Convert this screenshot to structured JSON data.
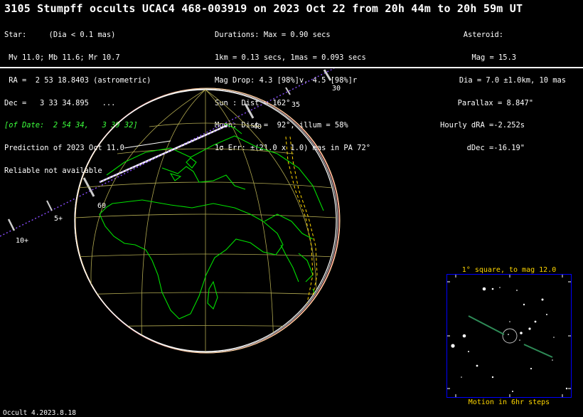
{
  "title": "3105 Stumpff occults UCAC4 468-003919 on 2023 Oct 22 from 20h 44m to 20h 59m UT",
  "star_info": [
    "Star:     (Dia < 0.1 mas)",
    " Mv 11.0; Mb 11.6; Mr 10.7",
    " RA =  2 53 18.8403 (astrometric)",
    "Dec =   3 33 34.895   ...",
    "[of Date:  2 54 34,   3 39 32]",
    "Prediction of 2023 Oct 11.0",
    "Reliable not available"
  ],
  "event_info": [
    "Durations: Max = 0.90 secs",
    "1km = 0.13 secs, 1mas = 0.093 secs",
    "Mag Drop: 4.3 [98%]v, 4.5 [98%]r",
    "Sun : Dist = 162°",
    "Moon: Dist =  92°, illum = 58%",
    "1σ Err: ±(21.0 x 1.0) mas in PA 72°"
  ],
  "asteroid_info": [
    "Asteroid:",
    "Mag = 15.3",
    "Dia = 7.0 ±1.0km, 10 mas",
    "Parallax = 8.847\"",
    "Hourly dRA =-2.252s",
    "dDec =-16.19\""
  ],
  "path_labels": [
    "30",
    "35",
    "40",
    "60",
    "5+",
    "10+"
  ],
  "star_chart": {
    "title": "1° square, to mag 12.0",
    "footer": "Motion in 6hr steps"
  },
  "version": "Occult 4.2023.8.18",
  "colors": {
    "continents": "#00e000",
    "grid": "#b0a850",
    "path_main": "#ffffff",
    "path_band": "#ffd700",
    "track": "#8a4dff",
    "motion": "#2e8b57",
    "chart_border": "#0000ff"
  }
}
